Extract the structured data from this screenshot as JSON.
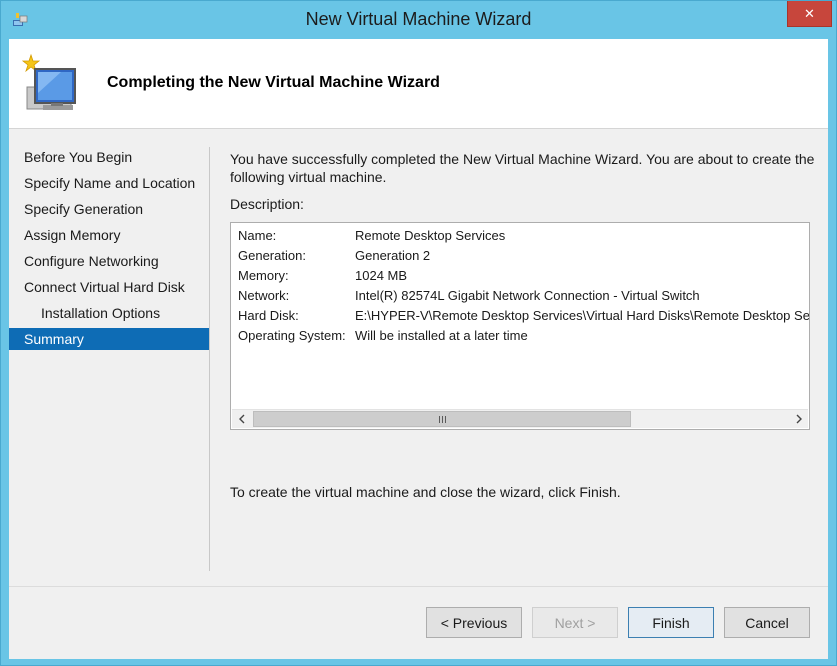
{
  "window": {
    "title": "New Virtual Machine Wizard",
    "close_label": "✕"
  },
  "header": {
    "title": "Completing the New Virtual Machine Wizard"
  },
  "nav": {
    "items": [
      {
        "label": "Before You Begin"
      },
      {
        "label": "Specify Name and Location"
      },
      {
        "label": "Specify Generation"
      },
      {
        "label": "Assign Memory"
      },
      {
        "label": "Configure Networking"
      },
      {
        "label": "Connect Virtual Hard Disk"
      },
      {
        "label": "Installation Options"
      },
      {
        "label": "Summary"
      }
    ],
    "selected": "Summary"
  },
  "content": {
    "intro": "You have successfully completed the New Virtual Machine Wizard. You are about to create the following virtual machine.",
    "description_label": "Description:",
    "description": [
      {
        "key": "Name:",
        "value": "Remote Desktop Services"
      },
      {
        "key": "Generation:",
        "value": "Generation 2"
      },
      {
        "key": "Memory:",
        "value": "1024 MB"
      },
      {
        "key": "Network:",
        "value": "Intel(R) 82574L Gigabit Network Connection - Virtual Switch"
      },
      {
        "key": "Hard Disk:",
        "value": "E:\\HYPER-V\\Remote Desktop Services\\Virtual Hard Disks\\Remote Desktop Servi"
      },
      {
        "key": "Operating System:",
        "value": "Will be installed at a later time"
      }
    ],
    "finish_note": "To create the virtual machine and close the wizard, click Finish."
  },
  "buttons": {
    "previous": "< Previous",
    "next": "Next >",
    "finish": "Finish",
    "cancel": "Cancel"
  },
  "colors": {
    "frame": "#69c5e6",
    "close": "#c7463c",
    "selection": "#0e6cb5"
  },
  "icons": {
    "app": "hyper-v-app-icon",
    "wizard": "new-vm-monitor-icon",
    "close": "close-icon",
    "scroll_left": "chevron-left-icon",
    "scroll_right": "chevron-right-icon"
  }
}
